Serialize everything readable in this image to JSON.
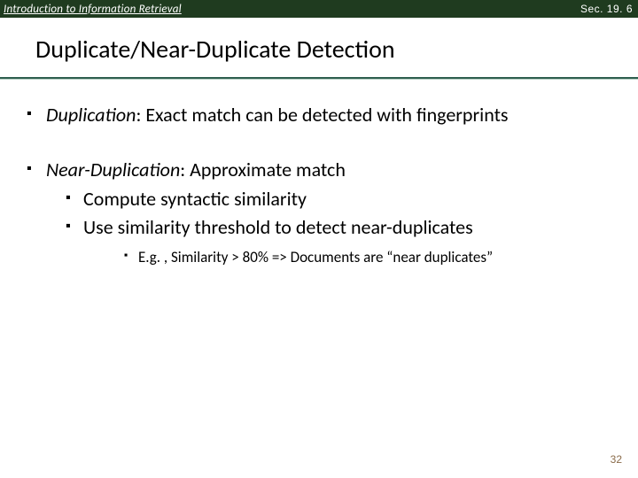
{
  "header": {
    "course": "Introduction to Information Retrieval",
    "section": "Sec. 19. 6"
  },
  "title": "Duplicate/Near-Duplicate Detection",
  "bullets": [
    {
      "lead": "Duplication",
      "rest": ": Exact match  can be detected with fingerprints"
    },
    {
      "lead": "Near-Duplication",
      "rest": ": Approximate match",
      "sub": [
        "Compute syntactic similarity",
        "Use similarity threshold to detect near-duplicates"
      ],
      "subsub": [
        "E.g. ,  Similarity > 80% => Documents are “near duplicates”"
      ]
    }
  ],
  "page_number": "32"
}
